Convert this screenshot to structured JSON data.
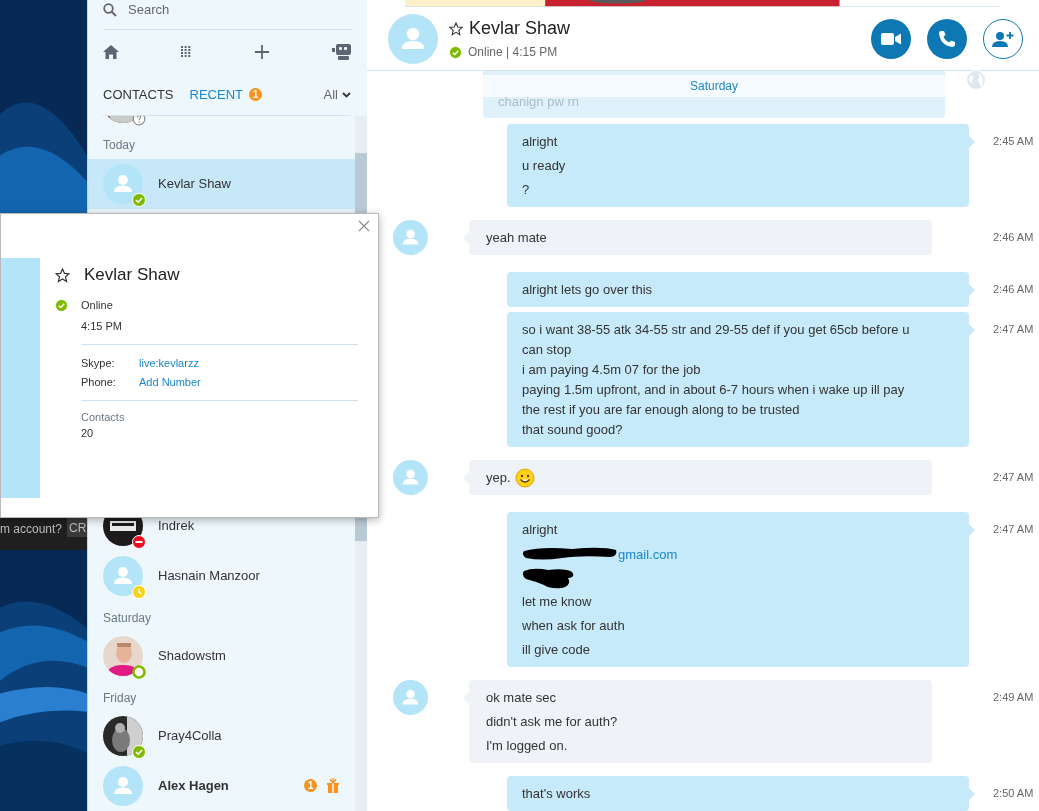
{
  "desktop": {
    "strip_texts": [
      "m account?",
      "CR"
    ]
  },
  "sidebar": {
    "search": {
      "placeholder": "Search"
    },
    "tabs": [
      {
        "label": "CONTACTS",
        "selected": false
      },
      {
        "label": "RECENT",
        "selected": true,
        "badge": "1"
      }
    ],
    "filter": {
      "label": "All"
    },
    "list": [
      {
        "kind": "contact_cut",
        "status": {
          "kind": "unknown"
        }
      },
      {
        "kind": "header",
        "label": "Today"
      },
      {
        "kind": "contact",
        "name": "Kevlar Shaw",
        "avatar": {
          "kind": "default"
        },
        "status": {
          "kind": "online",
          "color": "#7fba00"
        },
        "selected": true,
        "unread": false
      },
      {
        "kind": "contact",
        "name": "Indrek",
        "status": {
          "kind": "dnd",
          "color": "#e81123"
        },
        "selected": false,
        "unread": false
      },
      {
        "kind": "contact",
        "name": "Hasnain Manzoor",
        "avatar": {
          "kind": "default"
        },
        "status": {
          "kind": "away",
          "color": "#fcd116"
        },
        "selected": false,
        "unread": false
      },
      {
        "kind": "header",
        "label": "Saturday"
      },
      {
        "kind": "contact",
        "name": "Shadowstm",
        "status": {
          "kind": "mobile",
          "color": "#7fba00"
        },
        "selected": false,
        "unread": false
      },
      {
        "kind": "header",
        "label": "Friday"
      },
      {
        "kind": "contact",
        "name": "Pray4Colla",
        "status": {
          "kind": "online",
          "color": "#7fba00"
        },
        "selected": false,
        "unread": false
      },
      {
        "kind": "contact",
        "name": "Alex Hagen",
        "avatar": {
          "kind": "default"
        },
        "selected": false,
        "unread": true,
        "badge": "1",
        "gift": true
      }
    ]
  },
  "profile_card": {
    "name": "Kevlar Shaw",
    "status": {
      "kind": "online",
      "color": "#7fba00"
    },
    "status_text": "Online",
    "local_time": "4:15 PM",
    "fields": [
      {
        "label": "Skype:",
        "value": "live:kevlarzz"
      },
      {
        "label": "Phone:",
        "value": "Add Number"
      }
    ],
    "contacts_label": "Contacts",
    "contacts_count": "20"
  },
  "chat": {
    "header": {
      "name": "Kevlar Shaw",
      "status": {
        "kind": "online",
        "color": "#7fba00"
      },
      "status_line": "Online | 4:15 PM"
    },
    "day_divider": "Saturday",
    "faded_message": "chanign pw rn",
    "messages": [
      {
        "kind": "outgoing",
        "time": "2:45 AM",
        "lines": [
          {
            "kind": "text",
            "text": "alright"
          },
          {
            "kind": "text",
            "text": "u ready"
          },
          {
            "kind": "text",
            "text": "?"
          }
        ]
      },
      {
        "kind": "incoming",
        "time": "2:46 AM",
        "lines": [
          {
            "kind": "text",
            "text": "yeah mate"
          }
        ]
      },
      {
        "kind": "outgoing",
        "time": "2:46 AM",
        "lines": [
          {
            "kind": "text",
            "text": "alright lets go over this"
          }
        ]
      },
      {
        "kind": "outgoing",
        "time": "2:47 AM",
        "lines": [
          {
            "kind": "paragraph",
            "rows": [
              "so i want 38-55 atk 34-55 str and 29-55 def if you get 65cb before u can stop",
              "i am paying 4.5m 07 for the job",
              "paying 1.5m upfront, and in about 6-7 hours when i wake up ill pay the rest if you are far enough along to be trusted",
              "that sound good?"
            ]
          }
        ]
      },
      {
        "kind": "incoming",
        "time": "2:47 AM",
        "lines": [
          {
            "kind": "text",
            "text": "yep.",
            "emoji": true
          }
        ]
      },
      {
        "kind": "outgoing",
        "time": "2:47 AM",
        "lines": [
          {
            "kind": "text",
            "text": "alright"
          },
          {
            "kind": "redacted_link",
            "text": "gmail.com"
          },
          {
            "kind": "redacted"
          },
          {
            "kind": "text",
            "text": "let me know"
          },
          {
            "kind": "text",
            "text": "when ask for auth"
          },
          {
            "kind": "text",
            "text": "ill give code"
          }
        ]
      },
      {
        "kind": "incoming",
        "time": "2:49 AM",
        "lines": [
          {
            "kind": "text",
            "text": "ok mate sec"
          },
          {
            "kind": "text",
            "text": "didn't ask me for auth?"
          },
          {
            "kind": "text",
            "text": "I'm logged on."
          }
        ]
      },
      {
        "kind": "outgoing",
        "time": "2:50 AM",
        "lines": [
          {
            "kind": "text",
            "text": "that's works"
          }
        ]
      }
    ]
  }
}
